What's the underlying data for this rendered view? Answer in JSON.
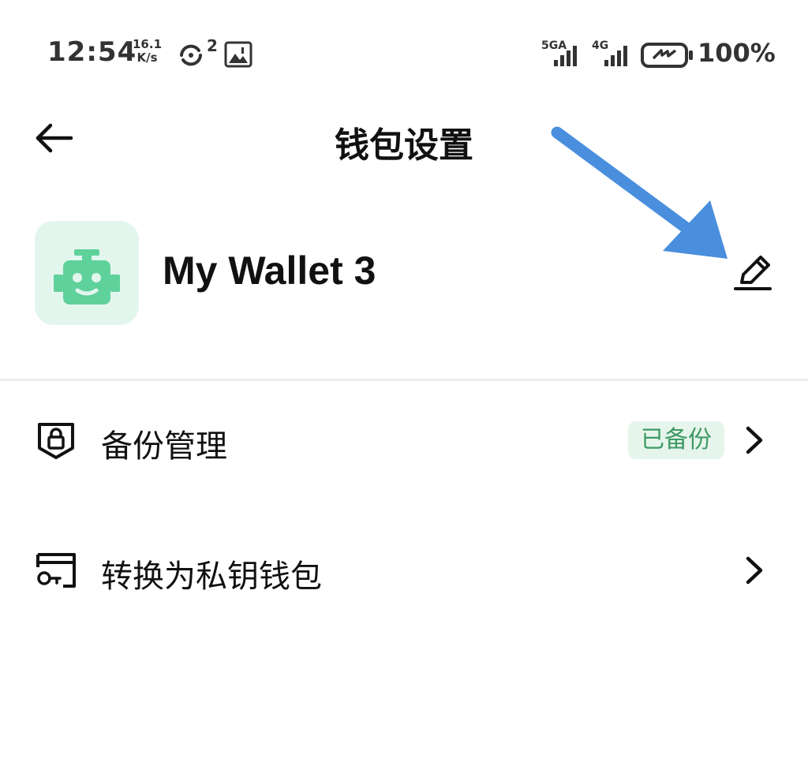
{
  "status_bar": {
    "time": "12:54",
    "speed_value": "16.1",
    "speed_unit": "K/s",
    "notification_count": "2",
    "net1_label": "5GA",
    "net2_label": "4G",
    "battery_percent": "100%",
    "icons": [
      "sync-icon",
      "image-alert-icon",
      "signal-5g-icon",
      "signal-4g-icon",
      "battery-charging-icon"
    ]
  },
  "header": {
    "title": "钱包设置",
    "back_icon": "arrow-left-icon"
  },
  "wallet": {
    "name": "My Wallet 3",
    "avatar_icon": "robot-icon",
    "edit_icon": "pencil-icon"
  },
  "menu": [
    {
      "label": "备份管理",
      "icon": "shield-lock-icon",
      "badge": "已备份"
    },
    {
      "label": "转换为私钥钱包",
      "icon": "key-card-icon"
    }
  ],
  "colors": {
    "avatar_bg": "#e3f6ee",
    "robot": "#5fd19b",
    "badge_bg": "#e6f5ec",
    "badge_text": "#3e9a64",
    "annotation_arrow": "#4a8fde"
  }
}
